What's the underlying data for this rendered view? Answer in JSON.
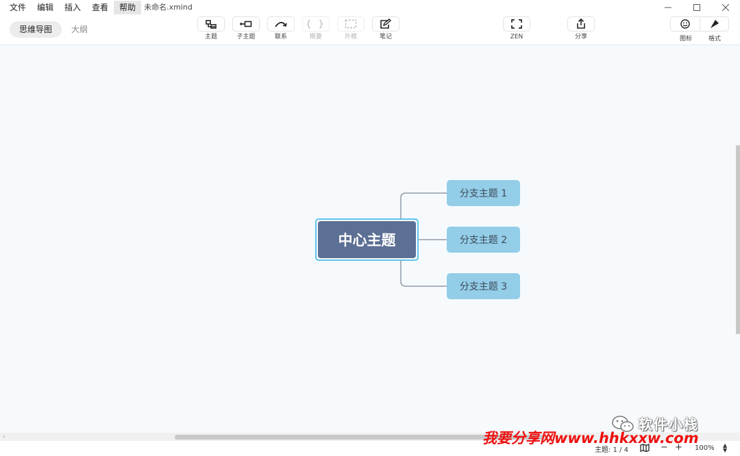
{
  "menu": {
    "items": [
      "文件",
      "编辑",
      "插入",
      "查看",
      "帮助"
    ],
    "active_index": 4,
    "document_title": "未命名.xmind"
  },
  "view_tabs": {
    "mindmap": "思维导图",
    "outline": "大纲"
  },
  "toolbar": {
    "topic": "主题",
    "subtopic": "子主题",
    "relationship": "联系",
    "summary": "概要",
    "boundary": "外框",
    "note": "笔记",
    "zen": "ZEN",
    "share": "分享",
    "icons": "图标",
    "format": "格式"
  },
  "map": {
    "central_topic": "中心主题",
    "branches": [
      "分支主题 1",
      "分支主题 2",
      "分支主题 3"
    ],
    "colors": {
      "central_fill": "#5c6f94",
      "central_selection": "#5cc3ec",
      "branch_fill": "#93cde7",
      "connector": "#8f9aa8",
      "canvas": "#f6fafd"
    }
  },
  "status": {
    "topic_count": "主题: 1 / 4",
    "zoom": "100%"
  },
  "watermarks": {
    "wechat_account": "软件小栈",
    "site": "我要分享网www.hhkxxw.com"
  }
}
